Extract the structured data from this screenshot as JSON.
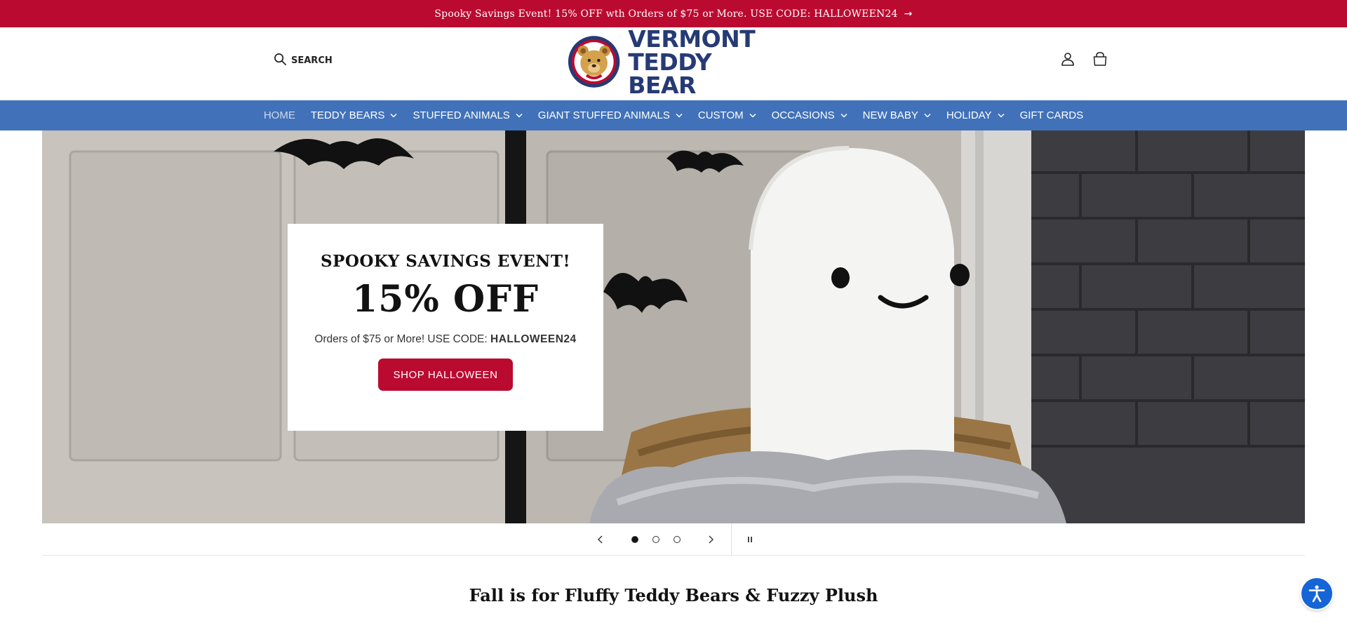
{
  "announcement": {
    "text": "Spooky Savings Event! 15% OFF wth Orders of $75 or More. USE CODE: HALLOWEEN24",
    "arrow": "→"
  },
  "header": {
    "search_label": "SEARCH",
    "logo": {
      "line1": "VERMONT",
      "line2": "TEDDY BEAR",
      "brand_color": "#263a75"
    },
    "icons": [
      "account-icon",
      "cart-icon"
    ]
  },
  "nav": {
    "items": [
      {
        "label": "HOME",
        "active": true,
        "dropdown": false
      },
      {
        "label": "TEDDY BEARS",
        "dropdown": true
      },
      {
        "label": "STUFFED ANIMALS",
        "dropdown": true
      },
      {
        "label": "GIANT STUFFED ANIMALS",
        "dropdown": true
      },
      {
        "label": "CUSTOM",
        "dropdown": true
      },
      {
        "label": "OCCASIONS",
        "dropdown": true
      },
      {
        "label": "NEW BABY",
        "dropdown": true
      },
      {
        "label": "HOLIDAY",
        "dropdown": true
      },
      {
        "label": "GIFT CARDS",
        "dropdown": false
      }
    ],
    "background": "#4172b9"
  },
  "hero": {
    "kicker": "SPOOKY SAVINGS EVENT!",
    "headline": "15% OFF",
    "sub_prefix": "Orders of $75 or More! USE CODE: ",
    "sub_code": "HALLOWEEN24",
    "cta_label": "SHOP HALLOWEEN",
    "accent": "#bb0a30"
  },
  "slider": {
    "slide_count": 3,
    "active_slide": 1,
    "prev_icon": "chevron-left-icon",
    "next_icon": "chevron-right-icon",
    "pause_icon": "pause-icon"
  },
  "section": {
    "title": "Fall is for Fluffy Teddy Bears & Fuzzy Plush"
  },
  "accessibility": {
    "icon": "accessibility-icon",
    "color": "#1565d8"
  }
}
